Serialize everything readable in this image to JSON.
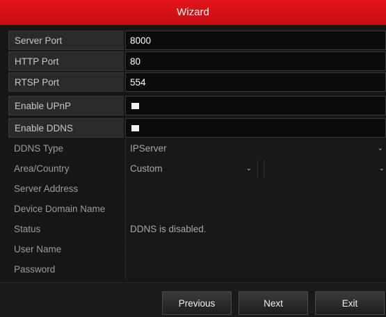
{
  "window": {
    "title": "Wizard"
  },
  "network": {
    "server_port": {
      "label": "Server Port",
      "value": "8000"
    },
    "http_port": {
      "label": "HTTP Port",
      "value": "80"
    },
    "rtsp_port": {
      "label": "RTSP Port",
      "value": "554"
    }
  },
  "upnp": {
    "label": "Enable UPnP",
    "checked": true
  },
  "ddns": {
    "enable_label": "Enable DDNS",
    "enabled": true,
    "type": {
      "label": "DDNS Type",
      "value": "IPServer"
    },
    "area": {
      "label": "Area/Country",
      "value": "Custom",
      "second_value": ""
    },
    "server_address": {
      "label": "Server Address",
      "value": ""
    },
    "device_domain": {
      "label": "Device Domain Name",
      "value": ""
    },
    "status": {
      "label": "Status",
      "value": "DDNS is disabled."
    },
    "user_name": {
      "label": "User Name",
      "value": ""
    },
    "password": {
      "label": "Password",
      "value": ""
    }
  },
  "footer": {
    "previous_label": "Previous",
    "next_label": "Next",
    "exit_label": "Exit"
  }
}
